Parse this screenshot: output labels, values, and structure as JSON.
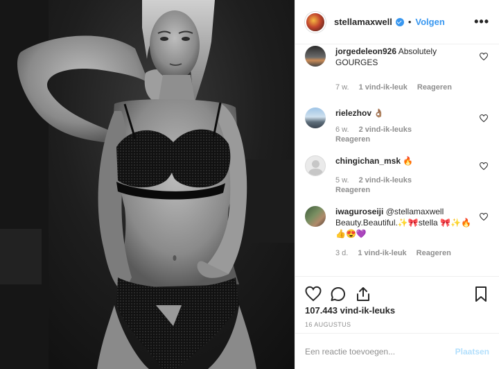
{
  "post": {
    "author": "stellamaxwell",
    "separator": "•",
    "follow_label": "Volgen",
    "more_label": "•••",
    "image_alt": "Black and white photo of a model in black lace lingerie"
  },
  "comments": [
    {
      "username": "jorgedeleon926",
      "text": "Absolutely GOURGES",
      "age": "7 w.",
      "likes": "1 vind-ik-leuk",
      "reply": "Reageren"
    },
    {
      "username": "rielezhov",
      "text": "👌🏽",
      "age": "6 w.",
      "likes": "2 vind-ik-leuks",
      "reply": "Reageren"
    },
    {
      "username": "chingichan_msk",
      "text": "🔥",
      "age": "5 w.",
      "likes": "2 vind-ik-leuks",
      "reply": "Reageren"
    },
    {
      "username": "iwaguroseiji",
      "text": "@stellamaxwell Beauty.Beautiful.✨🎀stella 🎀✨🔥👍😍💜",
      "age": "3 d.",
      "likes": "1 vind-ik-leuk",
      "reply": "Reageren"
    }
  ],
  "footer": {
    "likes_count": "107.443 vind-ik-leuks",
    "date": "16 AUGUSTUS",
    "comment_placeholder": "Een reactie toevoegen...",
    "post_label": "Plaatsen"
  },
  "colors": {
    "accent": "#3897f0",
    "post_disabled": "#b2dffc",
    "muted": "#8e8e8e"
  },
  "icons": {
    "like": "heart-icon",
    "comment": "comment-icon",
    "share": "share-icon",
    "save": "bookmark-icon",
    "verified": "verified-badge-icon"
  }
}
